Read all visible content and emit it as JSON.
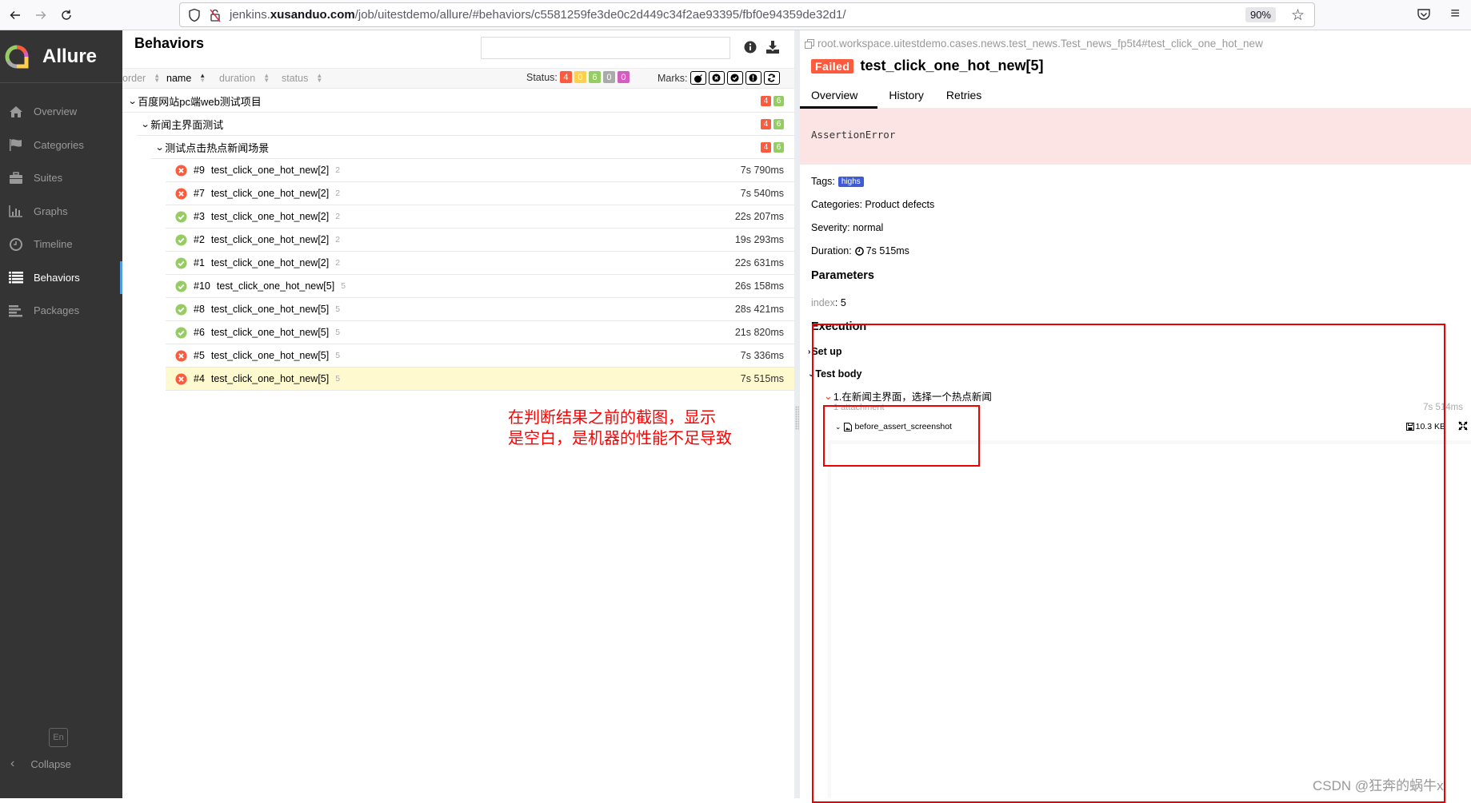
{
  "browser": {
    "url_host_prefix": "jenkins.",
    "url_host_domain": "xusanduo.com",
    "url_path": "/job/uitestdemo/allure/#behaviors/c5581259fe3de0c2d449c34f2ae93395/fbf0e94359de32d1/",
    "zoom": "90%",
    "icons": [
      "back-arrow",
      "forward-arrow",
      "reload",
      "shield",
      "insecure-lock",
      "bookmark-star",
      "pocket",
      "hamburger-menu"
    ]
  },
  "sidebar": {
    "brand": "Allure",
    "items": [
      {
        "label": "Overview",
        "icon": "home-icon",
        "active": false
      },
      {
        "label": "Categories",
        "icon": "flag-icon",
        "active": false
      },
      {
        "label": "Suites",
        "icon": "briefcase-icon",
        "active": false
      },
      {
        "label": "Graphs",
        "icon": "bar-chart-icon",
        "active": false
      },
      {
        "label": "Timeline",
        "icon": "clock-icon",
        "active": false
      },
      {
        "label": "Behaviors",
        "icon": "list-icon",
        "active": true
      },
      {
        "label": "Packages",
        "icon": "align-left-icon",
        "active": false
      }
    ],
    "language": "En",
    "collapse_label": "Collapse"
  },
  "behaviors": {
    "title": "Behaviors",
    "search_value": "",
    "sort_columns": [
      {
        "label": "order",
        "active": false
      },
      {
        "label": "name",
        "active": true
      },
      {
        "label": "duration",
        "active": false
      },
      {
        "label": "status",
        "active": false
      }
    ],
    "status_label": "Status:",
    "status_counts": [
      {
        "status": "failed",
        "count": "4",
        "color": "#fd5a3e"
      },
      {
        "status": "broken",
        "count": "0",
        "color": "#ffd050"
      },
      {
        "status": "passed",
        "count": "6",
        "color": "#97cc64"
      },
      {
        "status": "skipped",
        "count": "0",
        "color": "#aaaaaa"
      },
      {
        "status": "unknown",
        "count": "0",
        "color": "#d35ebe"
      }
    ],
    "marks_label": "Marks:",
    "marks": [
      "flaky-bomb-icon",
      "new-failed-icon",
      "new-passed-icon",
      "new-broken-icon",
      "retries-icon"
    ],
    "groups": [
      {
        "label": "百度网站pc端web测试项目",
        "failed": "4",
        "passed": "6"
      },
      {
        "label": "新闻主界面测试",
        "failed": "4",
        "passed": "6"
      },
      {
        "label": "测试点击热点新闻场景",
        "failed": "4",
        "passed": "6"
      }
    ],
    "tests": [
      {
        "order": "#9",
        "name": "test_click_one_hot_new[2]",
        "param": "2",
        "duration": "7s 790ms",
        "status": "failed",
        "selected": false
      },
      {
        "order": "#7",
        "name": "test_click_one_hot_new[2]",
        "param": "2",
        "duration": "7s 540ms",
        "status": "failed",
        "selected": false
      },
      {
        "order": "#3",
        "name": "test_click_one_hot_new[2]",
        "param": "2",
        "duration": "22s 207ms",
        "status": "passed",
        "selected": false
      },
      {
        "order": "#2",
        "name": "test_click_one_hot_new[2]",
        "param": "2",
        "duration": "19s 293ms",
        "status": "passed",
        "selected": false
      },
      {
        "order": "#1",
        "name": "test_click_one_hot_new[2]",
        "param": "2",
        "duration": "22s 631ms",
        "status": "passed",
        "selected": false
      },
      {
        "order": "#10",
        "name": "test_click_one_hot_new[5]",
        "param": "5",
        "duration": "26s 158ms",
        "status": "passed",
        "selected": false
      },
      {
        "order": "#8",
        "name": "test_click_one_hot_new[5]",
        "param": "5",
        "duration": "28s 421ms",
        "status": "passed",
        "selected": false
      },
      {
        "order": "#6",
        "name": "test_click_one_hot_new[5]",
        "param": "5",
        "duration": "21s 820ms",
        "status": "passed",
        "selected": false
      },
      {
        "order": "#5",
        "name": "test_click_one_hot_new[5]",
        "param": "5",
        "duration": "7s 336ms",
        "status": "failed",
        "selected": false
      },
      {
        "order": "#4",
        "name": "test_click_one_hot_new[5]",
        "param": "5",
        "duration": "7s 515ms",
        "status": "failed",
        "selected": true
      }
    ],
    "annotation": "在判断结果之前的截图，显示\n是空白，是机器的性能不足导致"
  },
  "detail": {
    "full_name": "root.workspace.uitestdemo.cases.news.test_news.Test_news_fp5t4#test_click_one_hot_new",
    "status_badge": "Failed",
    "title": "test_click_one_hot_new[5]",
    "tabs": [
      {
        "label": "Overview",
        "active": true
      },
      {
        "label": "History",
        "active": false
      },
      {
        "label": "Retries",
        "active": false
      }
    ],
    "error_message": "AssertionError",
    "tags_label": "Tags:",
    "tags": [
      "highs"
    ],
    "categories": "Categories: Product defects",
    "severity": "Severity: normal",
    "duration_label": "Duration:",
    "duration": "7s 515ms",
    "parameters_title": "Parameters",
    "parameters": [
      {
        "key": "index",
        "value": "5"
      }
    ],
    "execution_title": "Execution",
    "setup_label": "Set up",
    "test_body_label": "Test body",
    "step_label": "1.在新闻主界面，选择一个热点新闻",
    "step_attachments": "1 attachment",
    "step_duration": "7s 514ms",
    "attachment_name": "before_assert_screenshot",
    "attachment_size": "10.3 KB"
  },
  "watermark": "CSDN @狂奔的蜗牛x"
}
